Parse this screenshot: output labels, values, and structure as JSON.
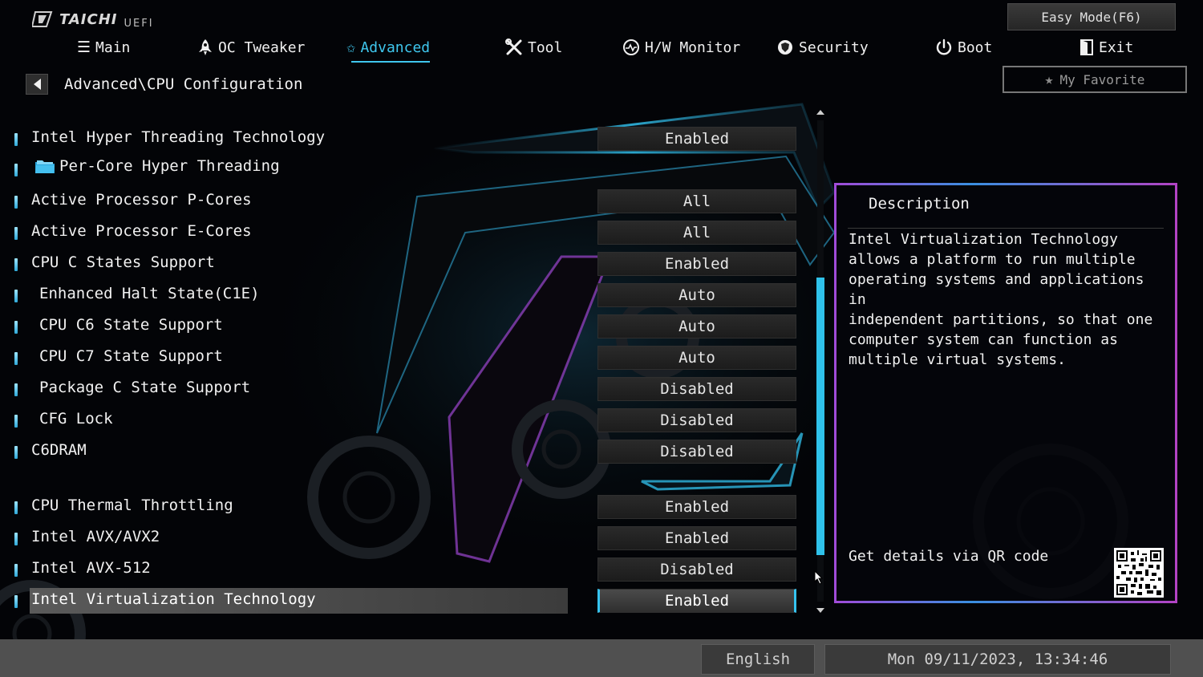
{
  "header": {
    "brand": "TAICHI",
    "uefi": "UEFI",
    "easy_mode": "Easy Mode(F6)",
    "my_favorite": "My Favorite"
  },
  "tabs": [
    {
      "label": "Main",
      "icon": "list-icon"
    },
    {
      "label": "OC Tweaker",
      "icon": "rocket-icon"
    },
    {
      "label": "Advanced",
      "icon": "star-icon",
      "active": true
    },
    {
      "label": "Tool",
      "icon": "tools-icon"
    },
    {
      "label": "H/W Monitor",
      "icon": "monitor-icon"
    },
    {
      "label": "Security",
      "icon": "shield-icon"
    },
    {
      "label": "Boot",
      "icon": "power-icon"
    },
    {
      "label": "Exit",
      "icon": "door-icon"
    }
  ],
  "breadcrumb": "Advanced\\CPU Configuration",
  "settings": [
    {
      "label": "Intel Hyper Threading Technology",
      "value": "Enabled"
    },
    {
      "label": "Per-Core Hyper Threading",
      "value": null,
      "folder": true
    },
    {
      "label": "Active Processor P-Cores",
      "value": "All"
    },
    {
      "label": "Active Processor E-Cores",
      "value": "All"
    },
    {
      "label": "CPU C States Support",
      "value": "Enabled"
    },
    {
      "label": "Enhanced Halt State(C1E)",
      "value": "Auto"
    },
    {
      "label": "CPU C6 State Support",
      "value": "Auto"
    },
    {
      "label": "CPU C7 State Support",
      "value": "Auto"
    },
    {
      "label": "Package C State Support",
      "value": "Disabled"
    },
    {
      "label": "CFG Lock",
      "value": "Disabled"
    },
    {
      "label": "C6DRAM",
      "value": "Disabled"
    },
    {
      "label": "CPU Thermal Throttling",
      "value": "Enabled"
    },
    {
      "label": "Intel AVX/AVX2",
      "value": "Enabled"
    },
    {
      "label": "Intel AVX-512",
      "value": "Disabled"
    },
    {
      "label": "Intel Virtualization Technology",
      "value": "Enabled",
      "selected": true
    }
  ],
  "description": {
    "title": "Description",
    "text": "Intel Virtualization Technology\nallows a platform to run multiple\noperating systems and applications in\nindependent partitions, so that one\ncomputer system can function as\nmultiple virtual systems.",
    "qr_label": "Get details via QR code"
  },
  "footer": {
    "language": "English",
    "datetime": "Mon 09/11/2023, 13:34:46"
  },
  "colors": {
    "accent": "#3fc7ee",
    "panel_border": "#a04bd8"
  }
}
